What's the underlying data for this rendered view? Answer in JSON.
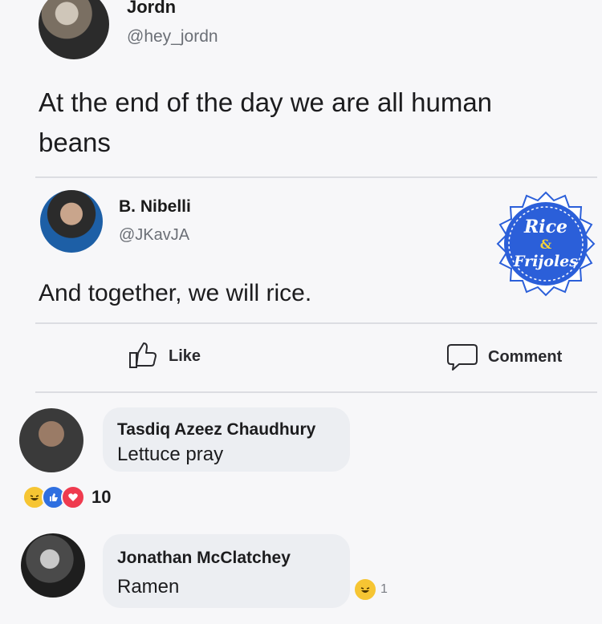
{
  "tweet1": {
    "name": "Jordn",
    "handle": "@hey_jordn",
    "text_line1": "At the end of the day we are all human",
    "text_line2": "beans"
  },
  "tweet2": {
    "name": "B. Nibelli",
    "handle": "@JKavJA",
    "text": "And together, we will rice."
  },
  "badge": {
    "line1": "Rice",
    "line2": "&",
    "line3": "Frijoles",
    "color": "#2b5fd9"
  },
  "actions": {
    "like_label": "Like",
    "comment_label": "Comment"
  },
  "comments": [
    {
      "name": "Tasdiq Azeez Chaudhury",
      "text": "Lettuce pray",
      "reaction_count": "10"
    },
    {
      "name": "Jonathan McClatchey",
      "text": "Ramen",
      "reaction_count": "1"
    }
  ]
}
